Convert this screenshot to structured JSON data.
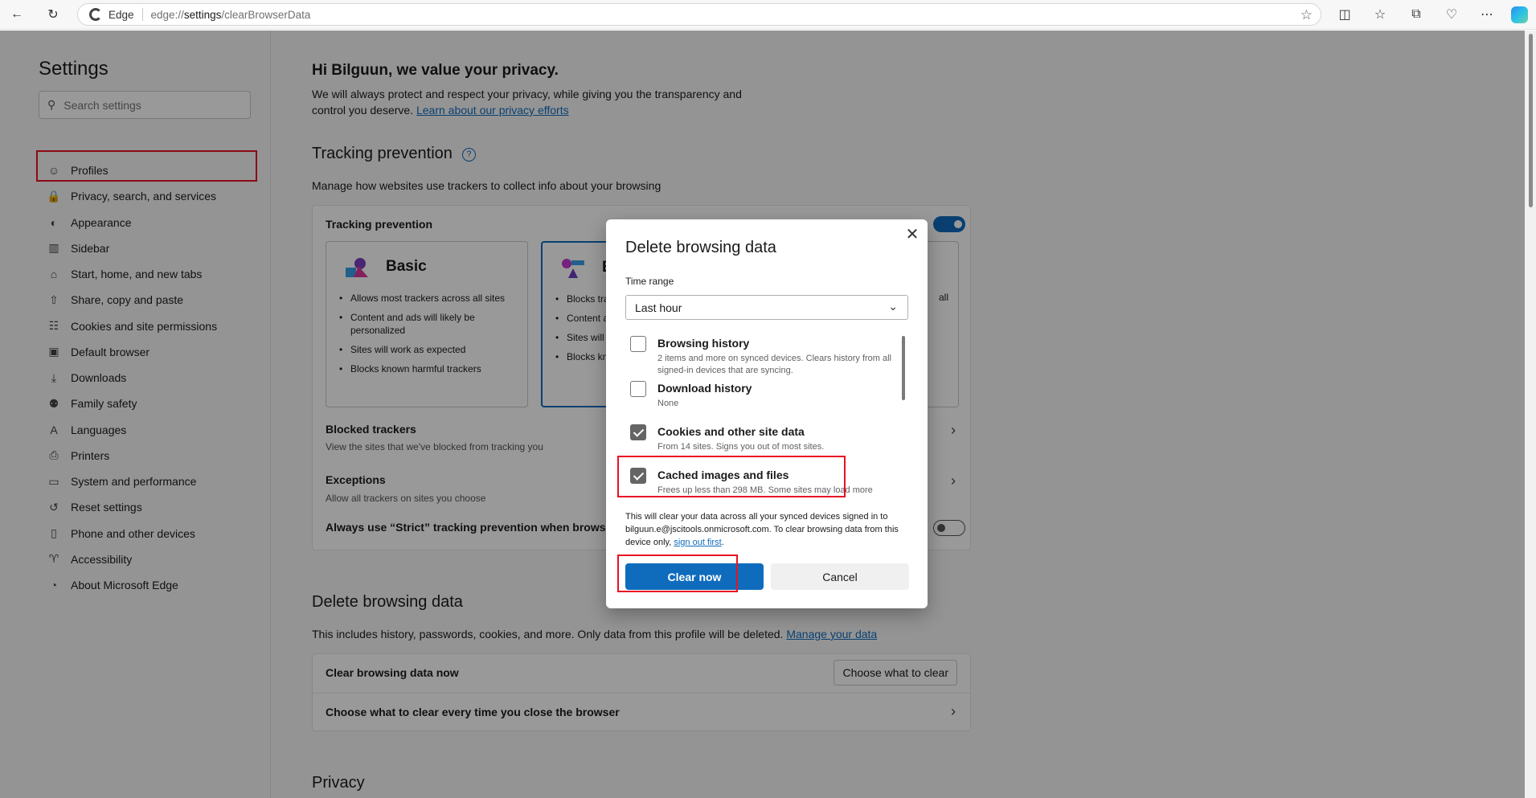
{
  "browser": {
    "site_label": "Edge",
    "url_scheme": "edge://",
    "url_host": "settings",
    "url_path": "/clearBrowserData"
  },
  "sidebar": {
    "title": "Settings",
    "search_placeholder": "Search settings",
    "items": [
      {
        "label": "Profiles",
        "icon": "profile-icon"
      },
      {
        "label": "Privacy, search, and services",
        "icon": "lock-icon"
      },
      {
        "label": "Appearance",
        "icon": "palette-icon"
      },
      {
        "label": "Sidebar",
        "icon": "sidebar-icon"
      },
      {
        "label": "Start, home, and new tabs",
        "icon": "home-icon"
      },
      {
        "label": "Share, copy and paste",
        "icon": "share-icon"
      },
      {
        "label": "Cookies and site permissions",
        "icon": "permissions-icon"
      },
      {
        "label": "Default browser",
        "icon": "browser-icon"
      },
      {
        "label": "Downloads",
        "icon": "download-icon"
      },
      {
        "label": "Family safety",
        "icon": "family-icon"
      },
      {
        "label": "Languages",
        "icon": "language-icon"
      },
      {
        "label": "Printers",
        "icon": "printer-icon"
      },
      {
        "label": "System and performance",
        "icon": "laptop-icon"
      },
      {
        "label": "Reset settings",
        "icon": "reset-icon"
      },
      {
        "label": "Phone and other devices",
        "icon": "phone-icon"
      },
      {
        "label": "Accessibility",
        "icon": "accessibility-icon"
      },
      {
        "label": "About Microsoft Edge",
        "icon": "edge-icon"
      }
    ]
  },
  "main": {
    "greeting": "Hi Bilguun, we value your privacy.",
    "intro_text": "We will always protect and respect your privacy, while giving you the transparency and control you deserve.",
    "intro_link": "Learn about our privacy efforts",
    "tracking_heading": "Tracking prevention",
    "tracking_desc": "Manage how websites use trackers to collect info about your browsing",
    "tracking_card_title": "Tracking prevention",
    "levels": [
      {
        "name": "Basic",
        "bullets": [
          "Allows most trackers across all sites",
          "Content and ads will likely be personalized",
          "Sites will work as expected",
          "Blocks known harmful trackers"
        ]
      },
      {
        "name": "B",
        "bullets": [
          "Blocks tra visited",
          "Content a personaliz",
          "Sites will",
          "Blocks kn"
        ]
      }
    ],
    "strict_fragment": "all",
    "blocked_title": "Blocked trackers",
    "blocked_sub": "View the sites that we've blocked from tracking you",
    "exceptions_title": "Exceptions",
    "exceptions_sub": "Allow all trackers on sites you choose",
    "always_strict": "Always use “Strict” tracking prevention when browsing",
    "delete_heading": "Delete browsing data",
    "delete_desc": "This includes history, passwords, cookies, and more. Only data from this profile will be deleted.",
    "delete_link": "Manage your data",
    "clear_now_row": "Clear browsing data now",
    "choose_button": "Choose what to clear",
    "choose_every_time": "Choose what to clear every time you close the browser",
    "privacy_heading": "Privacy"
  },
  "dialog": {
    "title": "Delete browsing data",
    "time_range_label": "Time range",
    "time_range_value": "Last hour",
    "options": [
      {
        "title": "Browsing history",
        "desc": "2 items and more on synced devices. Clears history from all signed-in devices that are syncing.",
        "checked": false
      },
      {
        "title": "Download history",
        "desc": "None",
        "checked": false
      },
      {
        "title": "Cookies and other site data",
        "desc": "From 14 sites. Signs you out of most sites.",
        "checked": true
      },
      {
        "title": "Cached images and files",
        "desc": "Frees up less than 298 MB. Some sites may load more",
        "checked": true
      }
    ],
    "sync_note": "This will clear your data across all your synced devices signed in to bilguun.e@jscitools.onmicrosoft.com. To clear browsing data from this device only,",
    "sign_out_link": "sign out first",
    "sync_note_end": ".",
    "clear_button": "Clear now",
    "cancel_button": "Cancel"
  },
  "colors": {
    "accent": "#0f6cbd",
    "highlight": "#e81123"
  }
}
